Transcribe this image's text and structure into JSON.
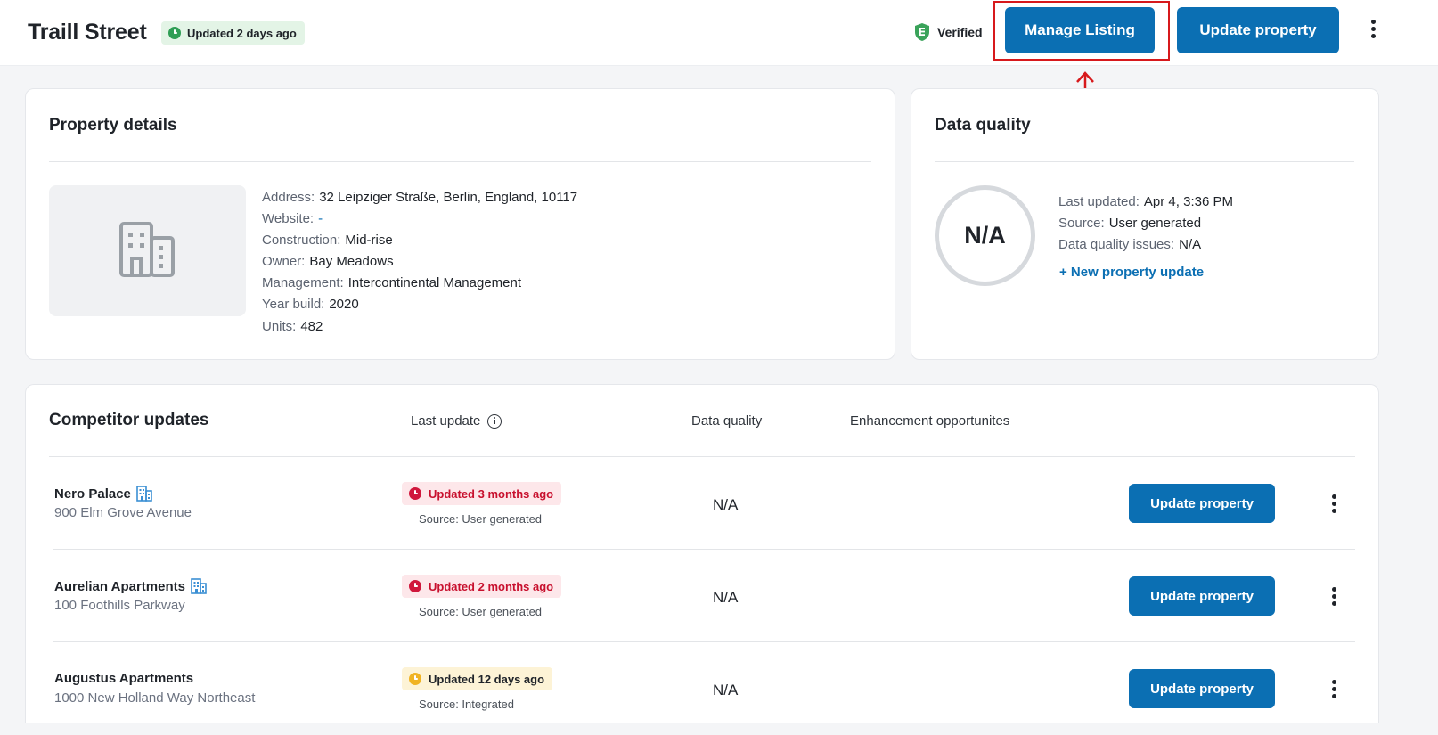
{
  "header": {
    "title": "Traill Street",
    "updated_chip": "Updated 2 days ago",
    "verified_label": "Verified",
    "manage_listing_label": "Manage Listing",
    "update_property_label": "Update property"
  },
  "property_details": {
    "title": "Property details",
    "fields": [
      {
        "label": "Address:",
        "value": "32 Leipziger Straße, Berlin, England, 10117"
      },
      {
        "label": "Website:",
        "value": "-"
      },
      {
        "label": "Construction:",
        "value": "Mid-rise"
      },
      {
        "label": "Owner:",
        "value": "Bay Meadows"
      },
      {
        "label": "Management:",
        "value": "Intercontinental Management"
      },
      {
        "label": "Year build:",
        "value": "2020"
      },
      {
        "label": "Units:",
        "value": "482"
      }
    ]
  },
  "data_quality": {
    "title": "Data quality",
    "score": "N/A",
    "fields": [
      {
        "label": "Last updated:",
        "value": "Apr 4, 3:36 PM"
      },
      {
        "label": "Source:",
        "value": "User generated"
      },
      {
        "label": "Data quality issues:",
        "value": "N/A"
      }
    ],
    "new_update_link": "+ New property update"
  },
  "competitors": {
    "title": "Competitor updates",
    "columns": {
      "last_update": "Last update",
      "data_quality": "Data quality",
      "enhancement": "Enhancement opportunites"
    },
    "rows": [
      {
        "name": "Nero Palace",
        "address": "900 Elm Grove Avenue",
        "status": "Updated 3 months ago",
        "status_color": "#c8102e",
        "source": "Source: User generated",
        "data_quality": "N/A",
        "button": "Update property",
        "has_building_icon": true
      },
      {
        "name": "Aurelian Apartments",
        "address": "100 Foothills Parkway",
        "status": "Updated 2 months ago",
        "status_color": "#c8102e",
        "source": "Source: User generated",
        "data_quality": "N/A",
        "button": "Update property",
        "has_building_icon": true
      },
      {
        "name": "Augustus Apartments",
        "address": "1000 New Holland Way Northeast",
        "status": "Updated 12 days ago",
        "status_color": "#f0b323",
        "source": "Source: Integrated",
        "data_quality": "N/A",
        "button": "Update property",
        "has_building_icon": false
      }
    ]
  },
  "colors": {
    "primary": "#0b6fb3",
    "highlight": "#d7191c",
    "success_chip": "#e3f4e6",
    "danger": "#c8102e",
    "warning": "#f0b323"
  }
}
